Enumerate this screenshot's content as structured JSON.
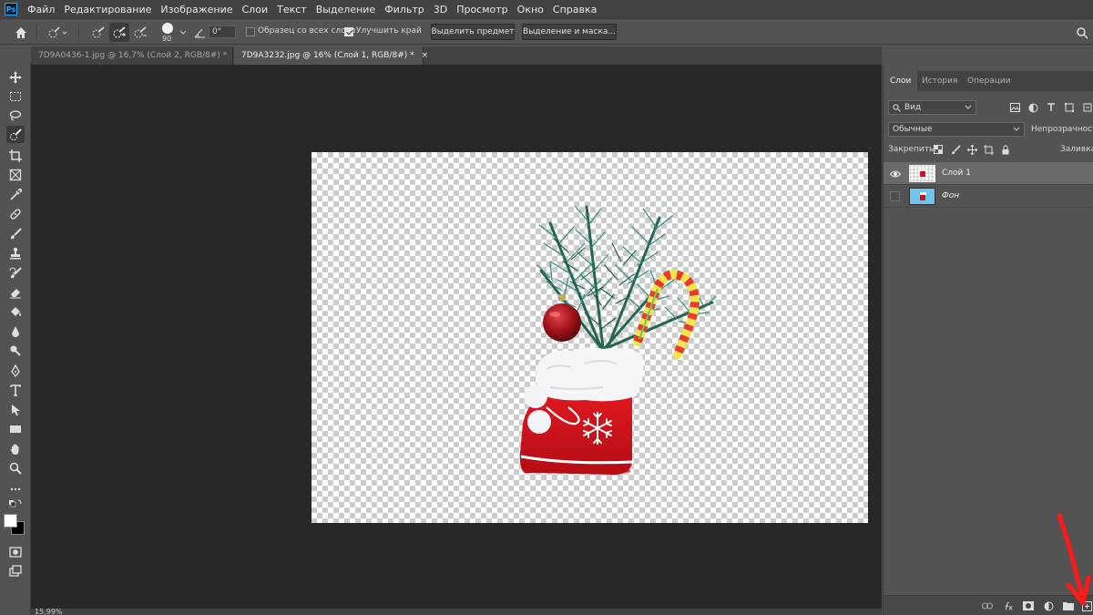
{
  "menu": [
    "Файл",
    "Редактирование",
    "Изображение",
    "Слои",
    "Текст",
    "Выделение",
    "Фильтр",
    "3D",
    "Просмотр",
    "Окно",
    "Справка"
  ],
  "app_logo": "Ps",
  "options": {
    "brush_size": "90",
    "angle": "0°",
    "sample_all_layers": "Образец со всех слоев",
    "sample_all_checked": false,
    "enhance_edge": "Улучшить край",
    "enhance_checked": true,
    "select_subject": "Выделить предмет",
    "select_and_mask": "Выделение и маска..."
  },
  "tabs": [
    {
      "label": "7D9A0436-1.jpg @ 16,7% (Слой 2, RGB/8#) *",
      "close": "×",
      "active": false
    },
    {
      "label": "7D9A3232.jpg @ 16% (Слой 1, RGB/8#) *",
      "close": "×",
      "active": true
    }
  ],
  "panel": {
    "tabs": [
      "Слои",
      "История",
      "Операции"
    ],
    "kind_filter": "Вид",
    "blend_mode": "Обычные",
    "opacity_label": "Непрозрачность:",
    "lock_label": "Закрепить:",
    "fill_label": "Заливка:",
    "layers": [
      {
        "name": "Слой 1",
        "visible": true,
        "active": true
      },
      {
        "name": "Фон",
        "visible": false,
        "active": false
      }
    ]
  },
  "status": {
    "zoom": "15,99%"
  },
  "colors": {
    "accent_arrow": "#ff1a1a",
    "canvas_bg": "#282828",
    "panel_bg": "#535353"
  }
}
